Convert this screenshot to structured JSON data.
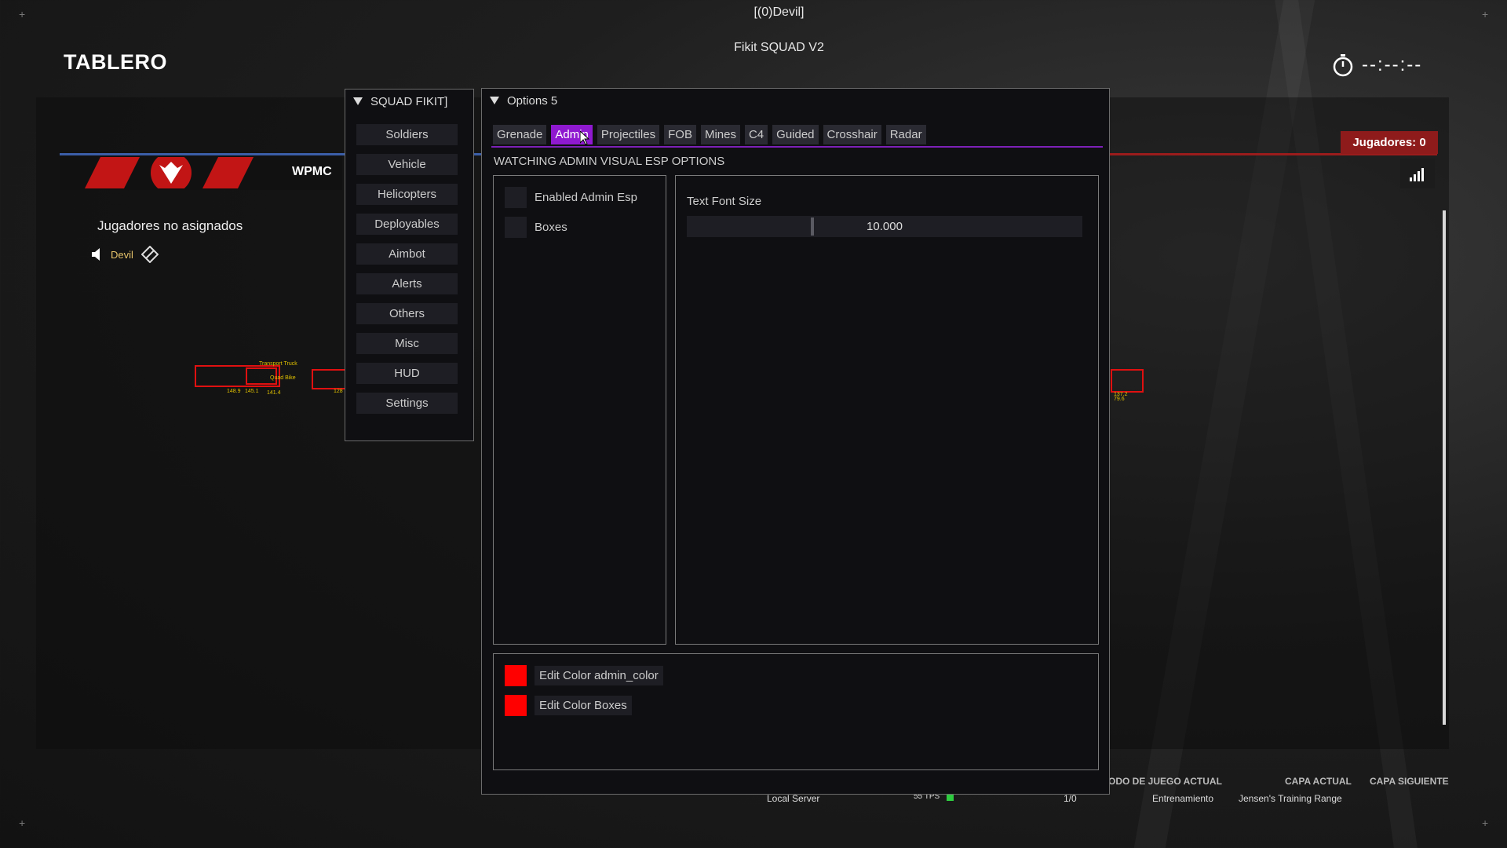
{
  "window_title": "[(0)Devil]",
  "menu_title": "Fikit SQUAD V2",
  "scoreboard": {
    "title": "TABLERO",
    "team_tag": "WPMC",
    "players_badge": "Jugadores: 0",
    "unassigned_label": "Jugadores no asignados",
    "player_name": "Devil",
    "timer": "--:--:--"
  },
  "squad_menu": {
    "header": "SQUAD FIKIT]",
    "items": [
      "Soldiers",
      "Vehicle",
      "Helicopters",
      "Deployables",
      "Aimbot",
      "Alerts",
      "Others",
      "Misc",
      "HUD",
      "Settings"
    ]
  },
  "options": {
    "header": "Options 5",
    "tabs": [
      "Grenade",
      "Admin",
      "Projectiles",
      "FOB",
      "Mines",
      "C4",
      "Guided",
      "Crosshair",
      "Radar"
    ],
    "active_tab": "Admin",
    "section_title": "WATCHING ADMIN VISUAL ESP OPTIONS",
    "checkboxes": [
      "Enabled Admin Esp",
      "Boxes"
    ],
    "slider": {
      "label": "Text Font Size",
      "value": "10.000"
    },
    "color_buttons": [
      "Edit Color admin_color",
      "Edit Color Boxes"
    ],
    "accent_color": "#8f19d0",
    "swatch_color": "#ff0000"
  },
  "status_bar": {
    "labels": [
      "ODO DE JUEGO ACTUAL",
      "CAPA ACTUAL",
      "CAPA SIGUIENTE"
    ],
    "server": "Local Server",
    "tps": "55 TPS",
    "players": "1/0",
    "mode": "Entrenamiento",
    "layer": "Jensen's Training Range"
  },
  "esp_labels": {
    "truck": "Transport Truck",
    "bike": "Quad Bike",
    "d1": "148.9",
    "d2": "145.1",
    "d3": "141.4",
    "d4": "128",
    "d5": "137.2",
    "d6": "79.6"
  }
}
